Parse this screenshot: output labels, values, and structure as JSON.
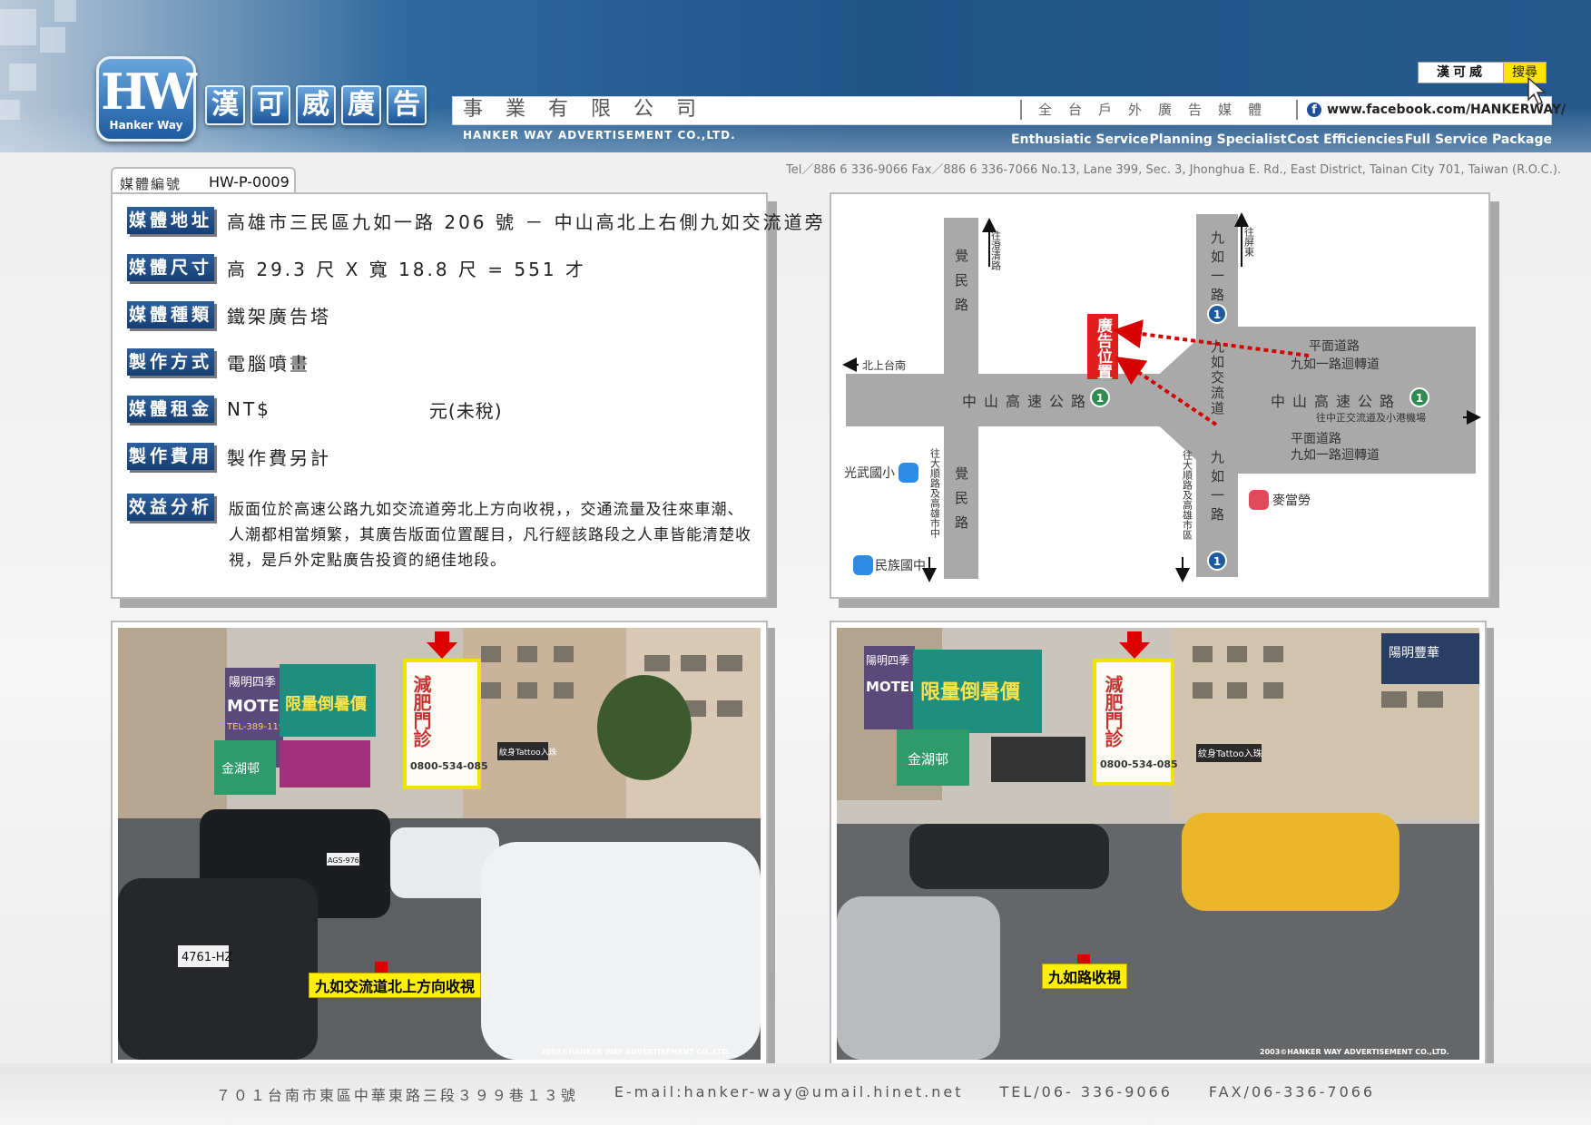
{
  "header": {
    "logo": {
      "mark": "HW",
      "sub": "Hanker Way"
    },
    "brand_chars": [
      "漢",
      "可",
      "威",
      "廣",
      "告"
    ],
    "company_cn": "事業有限公司",
    "company_en": "HANKER WAY ADVERTISEMENT CO.,LTD.",
    "slogan": "全台戶外廣告媒體",
    "facebook_url": "www.facebook.com/HANKERWAY/",
    "search_box_text": "漢可威",
    "search_button": "搜尋",
    "taglines": [
      "Enthusiatic Service",
      "Planning Specialist",
      "Cost Efficiencies",
      "Full Service Package"
    ],
    "contact_line": "Tel／886 6 336-9066   Fax／886 6 336-7066   No.13, Lane 399, Sec. 3, Jhonghua E. Rd., East District, Tainan City 701, Taiwan (R.O.C.)."
  },
  "media_number": {
    "label": "媒體編號",
    "value": "HW-P-0009"
  },
  "info": {
    "address": {
      "label": "媒體地址",
      "value": "高雄市三民區九如一路 206 號 － 中山高北上右側九如交流道旁"
    },
    "size": {
      "label": "媒體尺寸",
      "value": "高 29.3 尺 X 寬 18.8 尺 = 551 才"
    },
    "type": {
      "label": "媒體種類",
      "value": "鐵架廣告塔"
    },
    "method": {
      "label": "製作方式",
      "value": "電腦噴畫"
    },
    "rent": {
      "label": "媒體租金",
      "value": "NT$",
      "suffix": "元(未稅)"
    },
    "cost": {
      "label": "製作費用",
      "value": "製作費另計"
    },
    "benefit": {
      "label": "效益分析",
      "value": "版面位於高速公路九如交流道旁北上方向收視，，交通流量及往來車潮、人潮都相當頻繁，其廣告版面位置醒目，凡行經該路段之人車皆能清楚收視，是戶外定點廣告投資的絕佳地段。"
    }
  },
  "map": {
    "road_jueming": "覺民路",
    "road_jueming2": "覺民路",
    "road_jiuru": "九如一路",
    "road_jiuru2": "九如一路",
    "road_interchange": "九如交流道",
    "freeway_left": "中山高速公路",
    "freeway_right": "中山高速公路",
    "route_num": "1",
    "to_chengqing": "往澄清路",
    "to_pingtung": "往屏東",
    "to_north_tainan": "北上台南",
    "to_dashun": "往大順路及高雄市中",
    "to_dashun2": "往大順路及高雄市區",
    "to_airport": "往中正交流道及小港機場",
    "ramp_top": [
      "平面道路",
      "九如一路迴轉道"
    ],
    "ramp_bottom": [
      "平面道路",
      "九如一路迴轉道"
    ],
    "ad_position": "廣告位置",
    "poi_guangwu": "光武國小",
    "poi_minzu": "民族國中",
    "poi_mcd": "麥當勞",
    "colors": {
      "road": "#a9a9a9",
      "ad": "#e01e1e",
      "arrow": "#d60000"
    }
  },
  "photos": {
    "left_caption": "九如交流道北上方向收視",
    "right_caption": "九如路收視",
    "copyright": "2003©HANKER WAY ADVERTISEMENT CO.,LTD.",
    "billboard": {
      "title": "減肥門診",
      "phone": "0800-534-085"
    },
    "left_signs": {
      "motel": "MOTEL",
      "season": "陽明四季",
      "tel": "TEL-389-1197",
      "promo": "限量倒暑價",
      "hotel": "金湖邨",
      "tattoo": "紋身Tattoo入珠",
      "plate1": "4761-HZ",
      "plate2": "AGS-9761"
    },
    "right_signs": {
      "motel": "MOTEL",
      "season": "陽明四季",
      "promo": "限量倒暑價",
      "hotel": "金湖邨",
      "tattoo": "紋身Tattoo入珠",
      "yangming": "陽明豐華"
    }
  },
  "footer": {
    "address": "７０１台南市東區中華東路三段３９９巷１３號",
    "email": "E-mail:hanker-way@umail.hinet.net",
    "tel": "TEL/06- 336-9066",
    "fax": "FAX/06-336-7066"
  }
}
